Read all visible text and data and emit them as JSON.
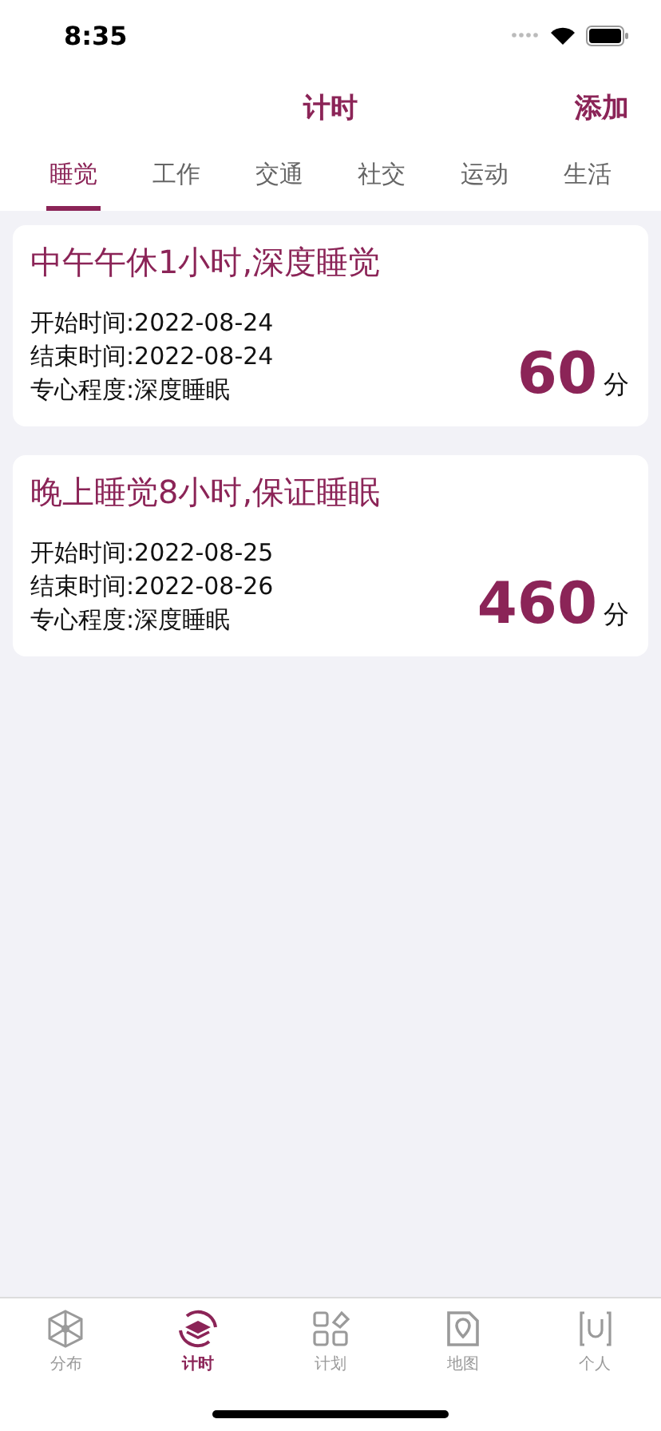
{
  "status_bar": {
    "time": "8:35"
  },
  "nav": {
    "title": "计时",
    "action": "添加"
  },
  "tabs": [
    {
      "label": "睡觉",
      "selected": true
    },
    {
      "label": "工作",
      "selected": false
    },
    {
      "label": "交通",
      "selected": false
    },
    {
      "label": "社交",
      "selected": false
    },
    {
      "label": "运动",
      "selected": false
    },
    {
      "label": "生活",
      "selected": false
    }
  ],
  "records": [
    {
      "title": "中午午休1小时,深度睡觉",
      "lines": [
        "开始时间:2022-08-24",
        "结束时间:2022-08-24",
        "专心程度:深度睡眠"
      ],
      "minutes": "60",
      "unit": "分"
    },
    {
      "title": "晚上睡觉8小时,保证睡眠",
      "lines": [
        "开始时间:2022-08-25",
        "结束时间:2022-08-26",
        "专心程度:深度睡眠"
      ],
      "minutes": "460",
      "unit": "分"
    }
  ],
  "tab_bar": [
    {
      "label": "分布",
      "selected": false
    },
    {
      "label": "计时",
      "selected": true
    },
    {
      "label": "计划",
      "selected": false
    },
    {
      "label": "地图",
      "selected": false
    },
    {
      "label": "个人",
      "selected": false
    }
  ]
}
